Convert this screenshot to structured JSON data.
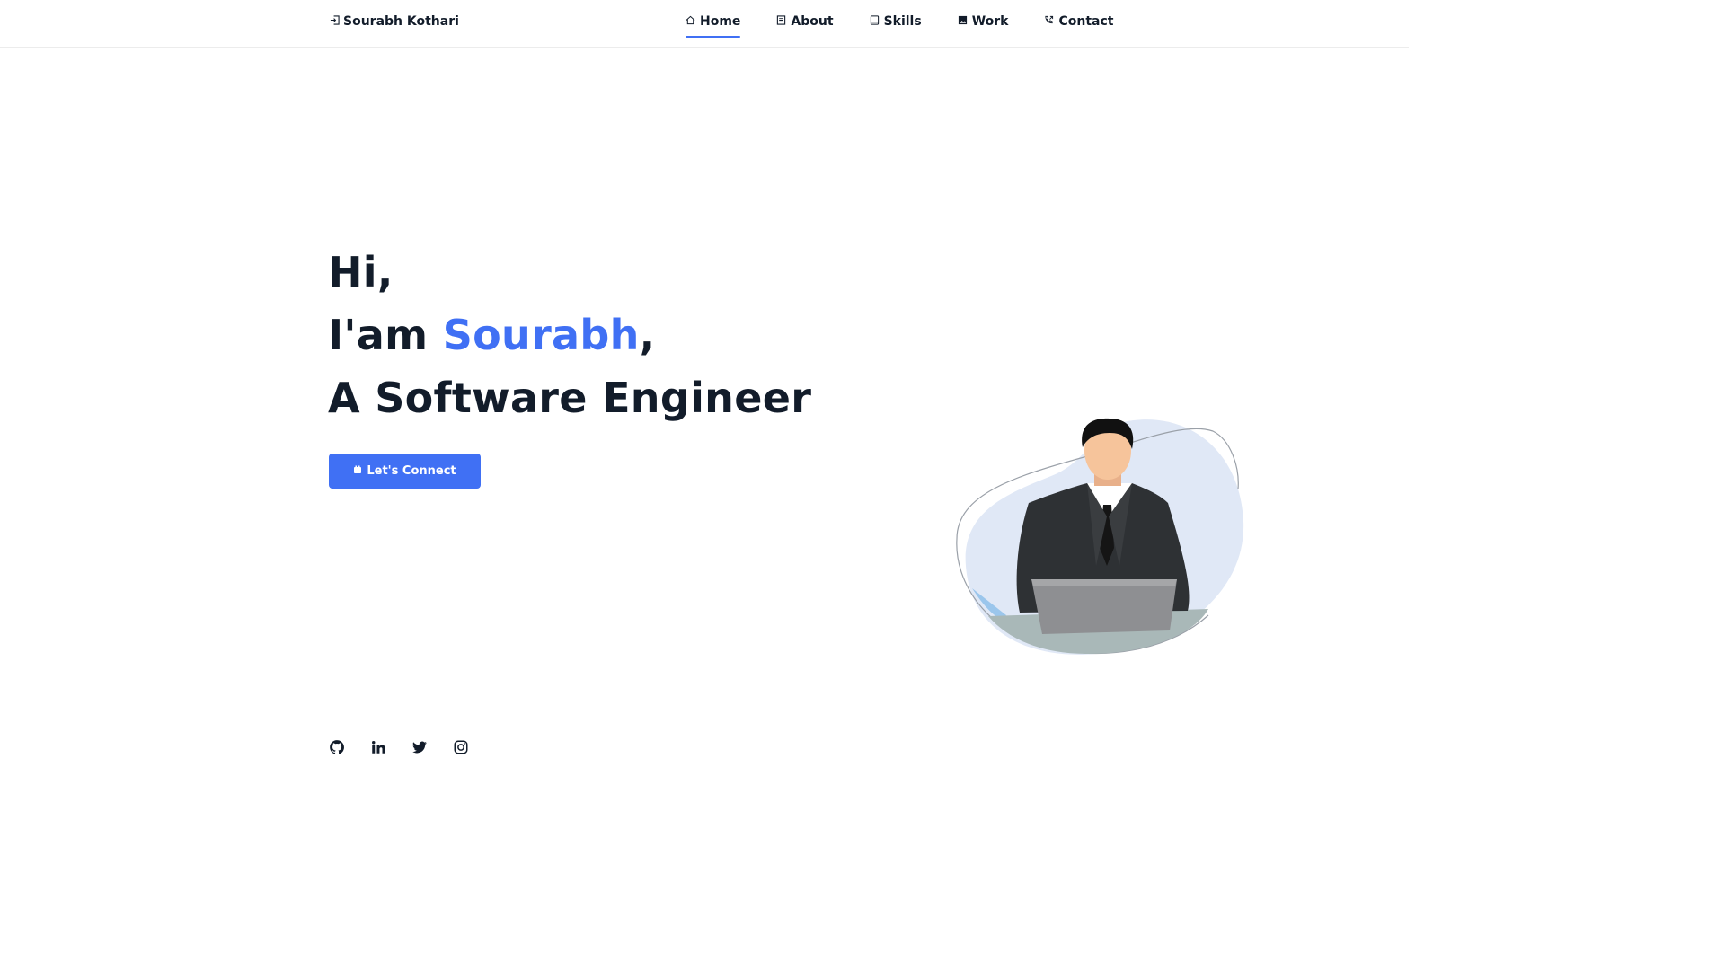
{
  "header": {
    "brand": "Sourabh Kothari",
    "nav": [
      {
        "label": "Home",
        "active": true,
        "icon": "home-icon"
      },
      {
        "label": "About",
        "active": false,
        "icon": "document-icon"
      },
      {
        "label": "Skills",
        "active": false,
        "icon": "laptop-icon"
      },
      {
        "label": "Work",
        "active": false,
        "icon": "image-icon"
      },
      {
        "label": "Contact",
        "active": false,
        "icon": "phone-icon"
      }
    ]
  },
  "hero": {
    "line1": "Hi,",
    "line2_prefix": "I'am ",
    "line2_name": "Sourabh",
    "line2_suffix": ",",
    "line3": "A Software Engineer",
    "cta_label": "Let's Connect"
  },
  "socials": [
    {
      "name": "github-icon"
    },
    {
      "name": "linkedin-icon"
    },
    {
      "name": "twitter-icon"
    },
    {
      "name": "instagram-icon"
    }
  ],
  "colors": {
    "accent": "#4070f4",
    "text": "#121c2a",
    "blob": "#e0e8f6"
  }
}
